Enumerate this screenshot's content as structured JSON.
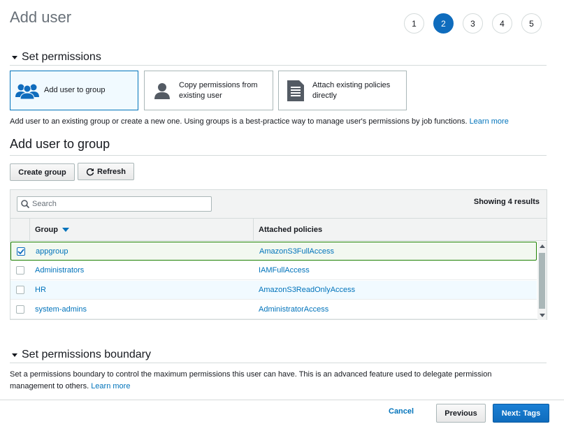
{
  "page": {
    "title": "Add user"
  },
  "steps": [
    "1",
    "2",
    "3",
    "4",
    "5"
  ],
  "active_step": "2",
  "permissions_section": {
    "title": "Set permissions",
    "options": [
      {
        "label": "Add user to group",
        "icon": "group-icon",
        "selected": true
      },
      {
        "label": "Copy permissions from existing user",
        "icon": "user-icon",
        "selected": false
      },
      {
        "label": "Attach existing policies directly",
        "icon": "document-icon",
        "selected": false
      }
    ],
    "description": "Add user to an existing group or create a new one. Using groups is a best-practice way to manage user's permissions by job functions.",
    "learn_more": "Learn more"
  },
  "group_section": {
    "title": "Add user to group",
    "create_group_label": "Create group",
    "refresh_label": "Refresh",
    "search_placeholder": "Search",
    "results_text": "Showing 4 results",
    "columns": {
      "group": "Group",
      "policies": "Attached policies"
    },
    "rows": [
      {
        "group": "appgroup",
        "policy": "AmazonS3FullAccess",
        "checked": true
      },
      {
        "group": "Administrators",
        "policy": "IAMFullAccess",
        "checked": false
      },
      {
        "group": "HR",
        "policy": "AmazonS3ReadOnlyAccess",
        "checked": false
      },
      {
        "group": "system-admins",
        "policy": "AdministratorAccess",
        "checked": false
      }
    ]
  },
  "boundary_section": {
    "title": "Set permissions boundary",
    "description": "Set a permissions boundary to control the maximum permissions this user can have. This is an advanced feature used to delegate permission management to others.",
    "learn_more": "Learn more"
  },
  "footer": {
    "cancel_label": "Cancel",
    "previous_label": "Previous",
    "next_label": "Next: Tags"
  },
  "colors": {
    "primary": "#0f6cbd",
    "link": "#0073bb",
    "selected_row_border": "#1d8102"
  }
}
